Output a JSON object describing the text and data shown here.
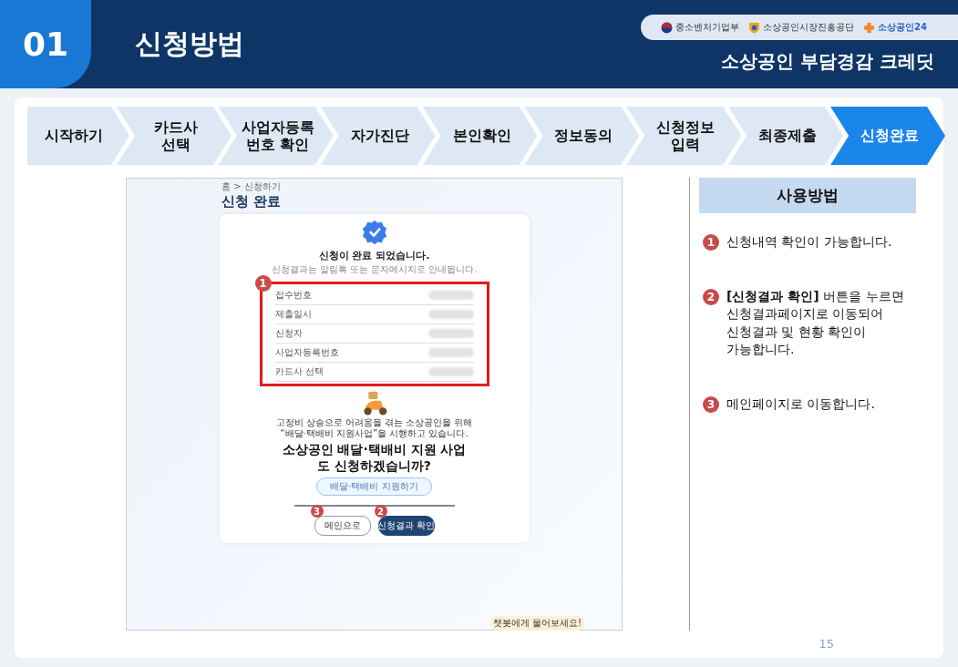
{
  "header": {
    "number": "01",
    "title": "신청방법",
    "logos": [
      "중소벤처기업부",
      "소상공인시장진흥공단",
      "소상공인24"
    ],
    "subtitle": "소상공인 부담경감 크레딧"
  },
  "steps": [
    {
      "label": "시작하기",
      "selected": false
    },
    {
      "label": "카드사\n선택",
      "selected": false
    },
    {
      "label": "사업자등록\n번호 확인",
      "selected": false
    },
    {
      "label": "자가진단",
      "selected": false
    },
    {
      "label": "본인확인",
      "selected": false
    },
    {
      "label": "정보동의",
      "selected": false
    },
    {
      "label": "신청정보\n입력",
      "selected": false
    },
    {
      "label": "최종제출",
      "selected": false
    },
    {
      "label": "신청완료",
      "selected": true
    }
  ],
  "screenshot": {
    "breadcrumb": "홈 > 신청하기",
    "page_title": "신청 완료",
    "message": "신청이 완료 되었습니다.",
    "sub_message": "신청결과는 알림톡 또는 문자메시지로 안내됩니다.",
    "details_badge": "1",
    "details": [
      "접수번호",
      "제출일시",
      "신청자",
      "사업자등록번호",
      "카드사 선택"
    ],
    "promo_lines": [
      "고정비 상승으로 어려움을 겪는 소상공인을 위해",
      "“배달·택배비 지원사업”을 시행하고 있습니다."
    ],
    "promo_headline": "**소상공인 배달·택배비 지원 사업**도 신청하겠습니까?",
    "promo_button": "배달·택배비 지원하기",
    "buttons": [
      {
        "label": "메인으로",
        "kind": "outline",
        "badge": "3"
      },
      {
        "label": "신청결과 확인",
        "kind": "primary",
        "badge": "2"
      }
    ],
    "chatbot": "챗봇에게 물어보세요!"
  },
  "guide": {
    "title": "사용방법",
    "items": [
      {
        "number": "1",
        "text": "신청내역 확인이 가능합니다."
      },
      {
        "number": "2",
        "text": "**[신청결과 확인]** 버튼을 누르면\n신청결과페이지로 이동되어\n신청결과 및 현황 확인이\n가능합니다."
      },
      {
        "number": "3",
        "text": "메인페이지로 이동합니다."
      }
    ]
  },
  "page_number": "15"
}
